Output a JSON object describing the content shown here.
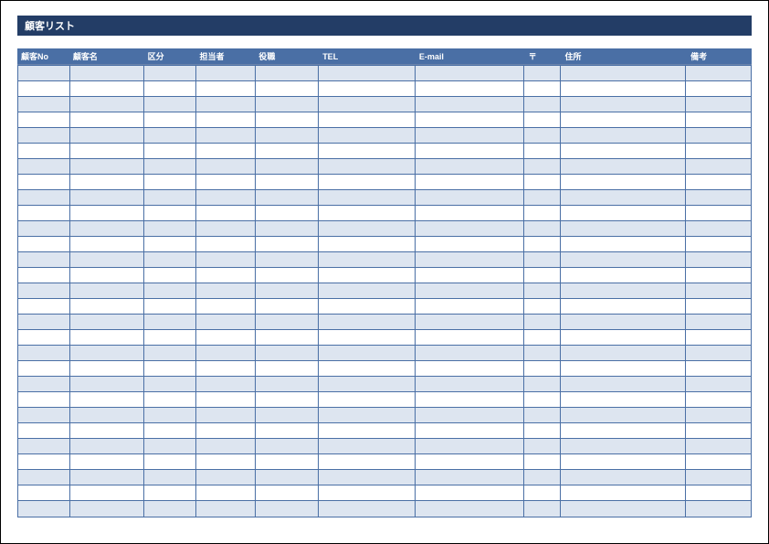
{
  "title": "顧客リスト",
  "columns": [
    {
      "key": "customer_no",
      "label": "顧客No"
    },
    {
      "key": "customer_name",
      "label": "顧客名"
    },
    {
      "key": "category",
      "label": "区分"
    },
    {
      "key": "contact_person",
      "label": "担当者"
    },
    {
      "key": "position",
      "label": "役職"
    },
    {
      "key": "tel",
      "label": "TEL"
    },
    {
      "key": "email",
      "label": "E-mail"
    },
    {
      "key": "postal",
      "label": "〒"
    },
    {
      "key": "address",
      "label": "住所"
    },
    {
      "key": "notes",
      "label": "備考"
    }
  ],
  "rows": [
    {
      "customer_no": "",
      "customer_name": "",
      "category": "",
      "contact_person": "",
      "position": "",
      "tel": "",
      "email": "",
      "postal": "",
      "address": "",
      "notes": ""
    },
    {
      "customer_no": "",
      "customer_name": "",
      "category": "",
      "contact_person": "",
      "position": "",
      "tel": "",
      "email": "",
      "postal": "",
      "address": "",
      "notes": ""
    },
    {
      "customer_no": "",
      "customer_name": "",
      "category": "",
      "contact_person": "",
      "position": "",
      "tel": "",
      "email": "",
      "postal": "",
      "address": "",
      "notes": ""
    },
    {
      "customer_no": "",
      "customer_name": "",
      "category": "",
      "contact_person": "",
      "position": "",
      "tel": "",
      "email": "",
      "postal": "",
      "address": "",
      "notes": ""
    },
    {
      "customer_no": "",
      "customer_name": "",
      "category": "",
      "contact_person": "",
      "position": "",
      "tel": "",
      "email": "",
      "postal": "",
      "address": "",
      "notes": ""
    },
    {
      "customer_no": "",
      "customer_name": "",
      "category": "",
      "contact_person": "",
      "position": "",
      "tel": "",
      "email": "",
      "postal": "",
      "address": "",
      "notes": ""
    },
    {
      "customer_no": "",
      "customer_name": "",
      "category": "",
      "contact_person": "",
      "position": "",
      "tel": "",
      "email": "",
      "postal": "",
      "address": "",
      "notes": ""
    },
    {
      "customer_no": "",
      "customer_name": "",
      "category": "",
      "contact_person": "",
      "position": "",
      "tel": "",
      "email": "",
      "postal": "",
      "address": "",
      "notes": ""
    },
    {
      "customer_no": "",
      "customer_name": "",
      "category": "",
      "contact_person": "",
      "position": "",
      "tel": "",
      "email": "",
      "postal": "",
      "address": "",
      "notes": ""
    },
    {
      "customer_no": "",
      "customer_name": "",
      "category": "",
      "contact_person": "",
      "position": "",
      "tel": "",
      "email": "",
      "postal": "",
      "address": "",
      "notes": ""
    },
    {
      "customer_no": "",
      "customer_name": "",
      "category": "",
      "contact_person": "",
      "position": "",
      "tel": "",
      "email": "",
      "postal": "",
      "address": "",
      "notes": ""
    },
    {
      "customer_no": "",
      "customer_name": "",
      "category": "",
      "contact_person": "",
      "position": "",
      "tel": "",
      "email": "",
      "postal": "",
      "address": "",
      "notes": ""
    },
    {
      "customer_no": "",
      "customer_name": "",
      "category": "",
      "contact_person": "",
      "position": "",
      "tel": "",
      "email": "",
      "postal": "",
      "address": "",
      "notes": ""
    },
    {
      "customer_no": "",
      "customer_name": "",
      "category": "",
      "contact_person": "",
      "position": "",
      "tel": "",
      "email": "",
      "postal": "",
      "address": "",
      "notes": ""
    },
    {
      "customer_no": "",
      "customer_name": "",
      "category": "",
      "contact_person": "",
      "position": "",
      "tel": "",
      "email": "",
      "postal": "",
      "address": "",
      "notes": ""
    },
    {
      "customer_no": "",
      "customer_name": "",
      "category": "",
      "contact_person": "",
      "position": "",
      "tel": "",
      "email": "",
      "postal": "",
      "address": "",
      "notes": ""
    },
    {
      "customer_no": "",
      "customer_name": "",
      "category": "",
      "contact_person": "",
      "position": "",
      "tel": "",
      "email": "",
      "postal": "",
      "address": "",
      "notes": ""
    },
    {
      "customer_no": "",
      "customer_name": "",
      "category": "",
      "contact_person": "",
      "position": "",
      "tel": "",
      "email": "",
      "postal": "",
      "address": "",
      "notes": ""
    },
    {
      "customer_no": "",
      "customer_name": "",
      "category": "",
      "contact_person": "",
      "position": "",
      "tel": "",
      "email": "",
      "postal": "",
      "address": "",
      "notes": ""
    },
    {
      "customer_no": "",
      "customer_name": "",
      "category": "",
      "contact_person": "",
      "position": "",
      "tel": "",
      "email": "",
      "postal": "",
      "address": "",
      "notes": ""
    },
    {
      "customer_no": "",
      "customer_name": "",
      "category": "",
      "contact_person": "",
      "position": "",
      "tel": "",
      "email": "",
      "postal": "",
      "address": "",
      "notes": ""
    },
    {
      "customer_no": "",
      "customer_name": "",
      "category": "",
      "contact_person": "",
      "position": "",
      "tel": "",
      "email": "",
      "postal": "",
      "address": "",
      "notes": ""
    },
    {
      "customer_no": "",
      "customer_name": "",
      "category": "",
      "contact_person": "",
      "position": "",
      "tel": "",
      "email": "",
      "postal": "",
      "address": "",
      "notes": ""
    },
    {
      "customer_no": "",
      "customer_name": "",
      "category": "",
      "contact_person": "",
      "position": "",
      "tel": "",
      "email": "",
      "postal": "",
      "address": "",
      "notes": ""
    },
    {
      "customer_no": "",
      "customer_name": "",
      "category": "",
      "contact_person": "",
      "position": "",
      "tel": "",
      "email": "",
      "postal": "",
      "address": "",
      "notes": ""
    },
    {
      "customer_no": "",
      "customer_name": "",
      "category": "",
      "contact_person": "",
      "position": "",
      "tel": "",
      "email": "",
      "postal": "",
      "address": "",
      "notes": ""
    },
    {
      "customer_no": "",
      "customer_name": "",
      "category": "",
      "contact_person": "",
      "position": "",
      "tel": "",
      "email": "",
      "postal": "",
      "address": "",
      "notes": ""
    },
    {
      "customer_no": "",
      "customer_name": "",
      "category": "",
      "contact_person": "",
      "position": "",
      "tel": "",
      "email": "",
      "postal": "",
      "address": "",
      "notes": ""
    },
    {
      "customer_no": "",
      "customer_name": "",
      "category": "",
      "contact_person": "",
      "position": "",
      "tel": "",
      "email": "",
      "postal": "",
      "address": "",
      "notes": ""
    }
  ]
}
